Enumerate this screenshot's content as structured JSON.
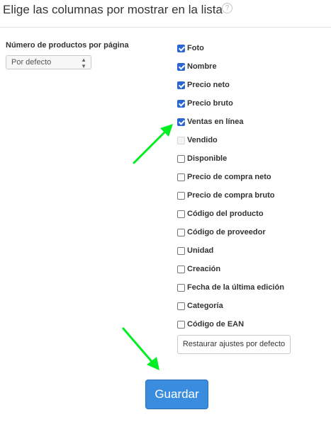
{
  "header": {
    "title": "Elige las columnas por mostrar en la lista",
    "help_icon": "?"
  },
  "per_page": {
    "label": "Número de productos por página",
    "selected": "Por defecto"
  },
  "columns": [
    {
      "label": "Foto",
      "checked": true
    },
    {
      "label": "Nombre",
      "checked": true
    },
    {
      "label": "Precio neto",
      "checked": true
    },
    {
      "label": "Precio bruto",
      "checked": true
    },
    {
      "label": "Ventas en línea",
      "checked": true
    },
    {
      "label": "Vendido",
      "checked": false,
      "disabled": true
    },
    {
      "label": "Disponible",
      "checked": false
    },
    {
      "label": "Precio de compra neto",
      "checked": false
    },
    {
      "label": "Precio de compra bruto",
      "checked": false
    },
    {
      "label": "Código del producto",
      "checked": false
    },
    {
      "label": "Código de proveedor",
      "checked": false
    },
    {
      "label": "Unidad",
      "checked": false
    },
    {
      "label": "Creación",
      "checked": false
    },
    {
      "label": "Fecha de la última edición",
      "checked": false
    },
    {
      "label": "Categoría",
      "checked": false
    },
    {
      "label": "Código de EAN",
      "checked": false
    }
  ],
  "buttons": {
    "reset_label": "Restaurar ajustes por defecto",
    "save_label": "Guardar"
  },
  "colors": {
    "accent": "#3a8dde",
    "checkbox": "#2a66d2",
    "annotation_arrow": "#00ee22"
  },
  "icons": {
    "help": "question-circle-icon",
    "select_arrows": "updown-chevron-icon",
    "annotation": "green-arrow-icon"
  }
}
